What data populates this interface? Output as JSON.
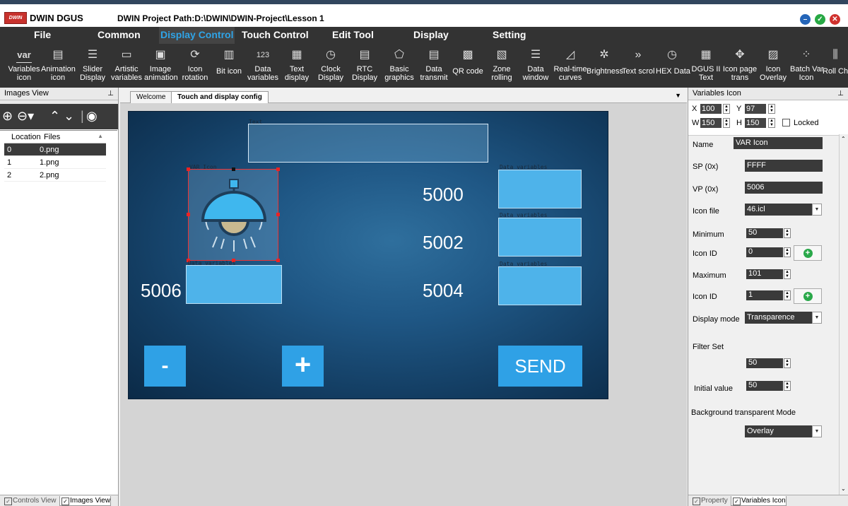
{
  "window": {
    "app_name": "DWIN DGUS",
    "logo_text": "DWIN",
    "project_path": "DWIN Project Path:D:\\DWIN\\DWIN-Project\\Lesson 1"
  },
  "menu": [
    "File",
    "Common",
    "Display Control",
    "Touch Control",
    "Edit Tool",
    "Display",
    "Setting"
  ],
  "toolbar": [
    {
      "label": "Variables\nicon",
      "icon": "var"
    },
    {
      "label": "Animation\nicon",
      "icon": "animation-icon"
    },
    {
      "label": "Slider\nDisplay",
      "icon": "slider-icon"
    },
    {
      "label": "Artistic\nvariables",
      "icon": "artistic-icon"
    },
    {
      "label": "Image\nanimation",
      "icon": "image-icon"
    },
    {
      "label": "Icon\nrotation",
      "icon": "rotation-icon"
    },
    {
      "label": "Bit icon",
      "icon": "bit-icon"
    },
    {
      "label": "Data\nvariables",
      "icon": "data-icon"
    },
    {
      "label": "Text\ndisplay",
      "icon": "text-icon"
    },
    {
      "label": "Clock\nDisplay",
      "icon": "clock-icon"
    },
    {
      "label": "RTC\nDisplay",
      "icon": "rtc-icon"
    },
    {
      "label": "Basic\ngraphics",
      "icon": "graphics-icon"
    },
    {
      "label": "Data\ntransmit",
      "icon": "transmit-icon"
    },
    {
      "label": "QR code",
      "icon": "qr-icon"
    },
    {
      "label": "Zone\nrolling",
      "icon": "zone-icon"
    },
    {
      "label": "Data\nwindow",
      "icon": "window-icon"
    },
    {
      "label": "Real-time\ncurves",
      "icon": "curves-icon"
    },
    {
      "label": "Brightness",
      "icon": "brightness-icon"
    },
    {
      "label": "Text scrol",
      "icon": "scroll-icon"
    },
    {
      "label": "HEX Data",
      "icon": "hex-icon"
    },
    {
      "label": "DGUS II\nText",
      "icon": "dgus-text-icon"
    },
    {
      "label": "Icon page\ntrans",
      "icon": "page-trans-icon"
    },
    {
      "label": "Icon\nOverlay",
      "icon": "overlay-icon"
    },
    {
      "label": "Batch Var\nIcon",
      "icon": "batch-icon"
    },
    {
      "label": "Roll Ch",
      "icon": "roll-icon"
    }
  ],
  "left_panel": {
    "title": "Images View",
    "columns": [
      "Location",
      "Files"
    ],
    "rows": [
      {
        "loc": "0",
        "file": "0.png"
      },
      {
        "loc": "1",
        "file": "1.png"
      },
      {
        "loc": "2",
        "file": "2.png"
      }
    ],
    "tabs": [
      "Controls View",
      "Images View"
    ]
  },
  "doc_tabs": [
    "Welcome",
    "Touch and display config"
  ],
  "canvas": {
    "text_label": "Text",
    "var_icon_label": "VAR Icon",
    "data_label": "Data variables",
    "num_left": "5006",
    "nums_right": [
      "5000",
      "5002",
      "5004"
    ],
    "btn_minus": "-",
    "btn_plus": "+",
    "btn_send": "SEND"
  },
  "right_panel": {
    "title": "Variables Icon",
    "x": "100",
    "y": "97",
    "w": "150",
    "h": "150",
    "locked_label": "Locked",
    "name_label": "Name",
    "name": "VAR Icon",
    "sp_label": "SP (0x)",
    "sp": "FFFF",
    "vp_label": "VP (0x)",
    "vp": "5006",
    "iconfile_label": "Icon file",
    "iconfile": "46.icl",
    "min_label": "Minimum",
    "min": "50",
    "iconid_label": "Icon ID",
    "iconid_min": "0",
    "max_label": "Maximum",
    "max": "101",
    "iconid_max": "1",
    "display_mode_label": "Display mode",
    "display_mode": "Transparence",
    "filter_label": "Filter Set",
    "filter": "50",
    "initial_label": "Initial value",
    "initial": "50",
    "bg_mode_label": "Background transparent Mode",
    "bg_mode": "Overlay",
    "tabs": [
      "Property",
      "Variables Icon"
    ]
  }
}
